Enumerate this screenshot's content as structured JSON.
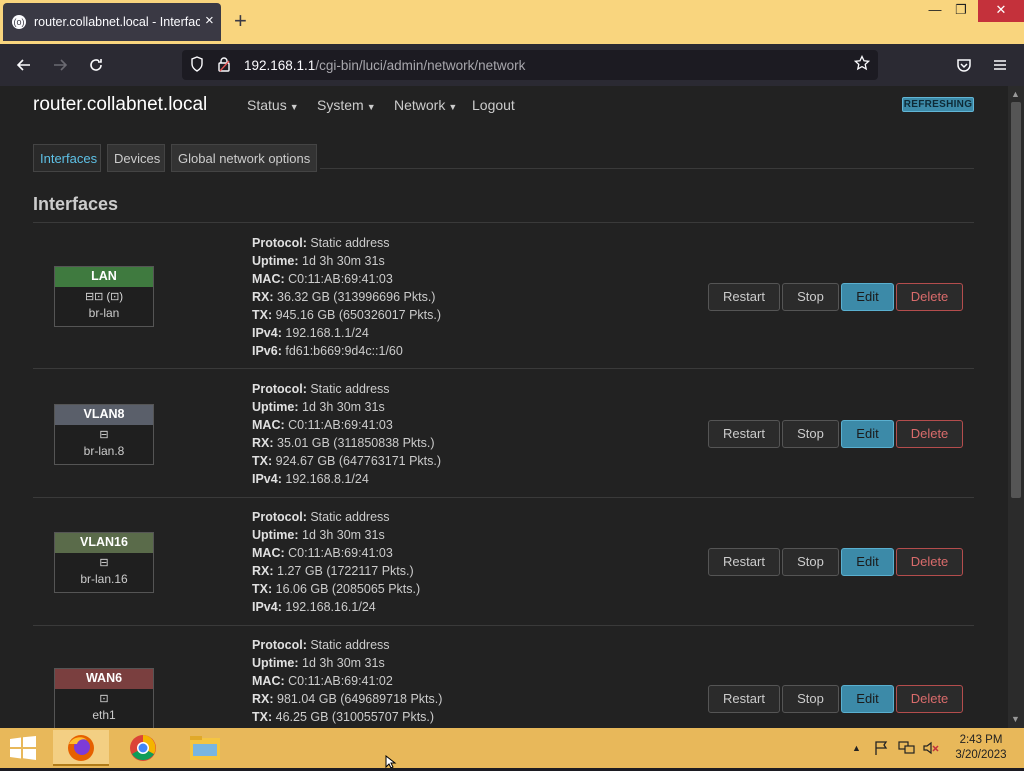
{
  "browser": {
    "tab_title": "router.collabnet.local - Interface",
    "tab_favicon": "(o)",
    "tab_close": "×",
    "new_tab": "+",
    "url_host": "192.168.1.1",
    "url_path": "/cgi-bin/luci/admin/network/network",
    "controls": {
      "minimize": "—",
      "maximize": "❐",
      "close": "✕"
    }
  },
  "header": {
    "brand": "router.collabnet.local",
    "menu": [
      "Status",
      "System",
      "Network",
      "Logout"
    ],
    "refresh_badge": "REFRESHING"
  },
  "tabs": [
    "Interfaces",
    "Devices",
    "Global network options"
  ],
  "section_title": "Interfaces",
  "labels": {
    "protocol": "Protocol:",
    "uptime": "Uptime:",
    "mac": "MAC:",
    "rx": "RX:",
    "tx": "TX:",
    "ipv4": "IPv4:",
    "ipv6": "IPv6:"
  },
  "buttons": {
    "restart": "Restart",
    "stop": "Stop",
    "edit": "Edit",
    "delete": "Delete"
  },
  "interfaces": [
    {
      "name": "LAN",
      "color": "#3f7a3f",
      "device": "br-lan",
      "icons": "⊟⊡ (⊡)",
      "protocol": "Static address",
      "uptime": "1d 3h 30m 31s",
      "mac": "C0:11:AB:69:41:03",
      "rx": "36.32 GB (313996696 Pkts.)",
      "tx": "945.16 GB (650326017 Pkts.)",
      "ipv4": "192.168.1.1/24",
      "ipv6": "fd61:b669:9d4c::1/60"
    },
    {
      "name": "VLAN8",
      "color": "#5a5f6a",
      "device": "br-lan.8",
      "icons": "⊟",
      "protocol": "Static address",
      "uptime": "1d 3h 30m 31s",
      "mac": "C0:11:AB:69:41:03",
      "rx": "35.01 GB (311850838 Pkts.)",
      "tx": "924.67 GB (647763171 Pkts.)",
      "ipv4": "192.168.8.1/24"
    },
    {
      "name": "VLAN16",
      "color": "#5a6b4a",
      "device": "br-lan.16",
      "icons": "⊟",
      "protocol": "Static address",
      "uptime": "1d 3h 30m 31s",
      "mac": "C0:11:AB:69:41:03",
      "rx": "1.27 GB (1722117 Pkts.)",
      "tx": "16.06 GB (2085065 Pkts.)",
      "ipv4": "192.168.16.1/24"
    },
    {
      "name": "WAN6",
      "color": "#7a3f3f",
      "device": "eth1",
      "icons": "⊡",
      "protocol": "Static address",
      "uptime": "1d 3h 30m 31s",
      "mac": "C0:11:AB:69:41:02",
      "rx": "981.04 GB (649689718 Pkts.)",
      "tx": "46.25 GB (310055707 Pkts.)"
    }
  ],
  "taskbar": {
    "time": "2:43 PM",
    "date": "3/20/2023"
  },
  "colors": {
    "accent": "#3c8aa8",
    "danger": "#d96b6b",
    "page_bg": "#222222"
  }
}
